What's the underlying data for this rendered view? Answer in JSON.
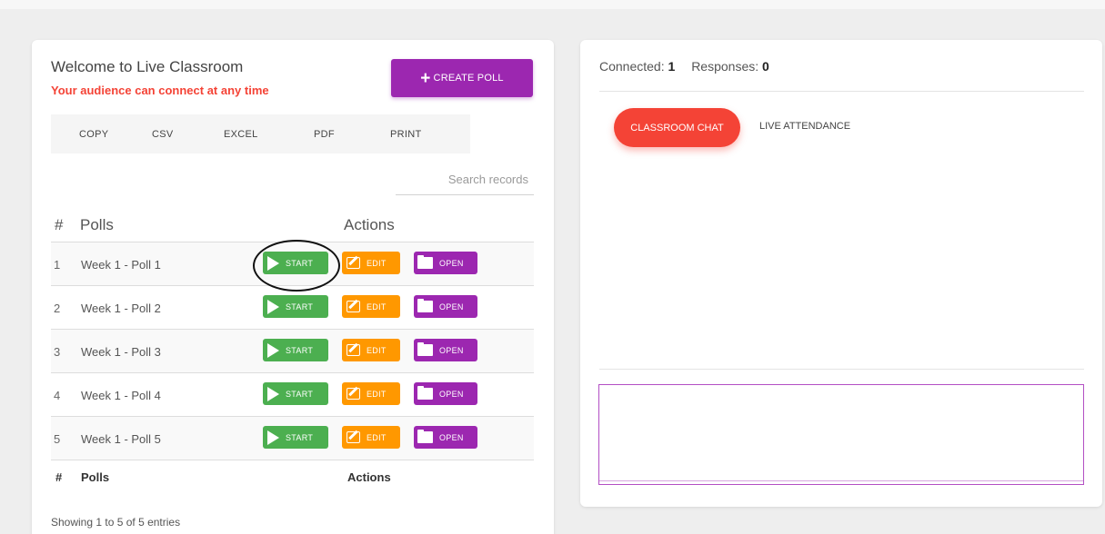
{
  "welcome": "Welcome to Live Classroom",
  "audience_note": "Your audience can connect at any time",
  "create_poll_label": "CREATE POLL",
  "export_buttons": [
    "COPY",
    "CSV",
    "EXCEL",
    "PDF",
    "PRINT"
  ],
  "search_placeholder": "Search records",
  "table": {
    "header": {
      "num": "#",
      "polls": "Polls",
      "actions": "Actions"
    },
    "rows": [
      {
        "num": "1",
        "name": "Week 1 - Poll 1",
        "start": "START",
        "edit": "EDIT",
        "open": "OPEN"
      },
      {
        "num": "2",
        "name": "Week 1 - Poll 2",
        "start": "START",
        "edit": "EDIT",
        "open": "OPEN"
      },
      {
        "num": "3",
        "name": "Week 1 - Poll 3",
        "start": "START",
        "edit": "EDIT",
        "open": "OPEN"
      },
      {
        "num": "4",
        "name": "Week 1 - Poll 4",
        "start": "START",
        "edit": "EDIT",
        "open": "OPEN"
      },
      {
        "num": "5",
        "name": "Week 1 - Poll 5",
        "start": "START",
        "edit": "EDIT",
        "open": "OPEN"
      }
    ],
    "footer": {
      "num": "#",
      "polls": "Polls",
      "actions": "Actions"
    }
  },
  "showing": "Showing 1 to 5 of 5 entries",
  "stats": {
    "connected_label": "Connected:",
    "connected_value": "1",
    "responses_label": "Responses:",
    "responses_value": "0"
  },
  "tabs": {
    "chat": "CLASSROOM CHAT",
    "attendance": "LIVE ATTENDANCE"
  },
  "colors": {
    "purple": "#9c27b0",
    "red": "#f44336",
    "green": "#4caf50",
    "orange": "#ff9800"
  }
}
